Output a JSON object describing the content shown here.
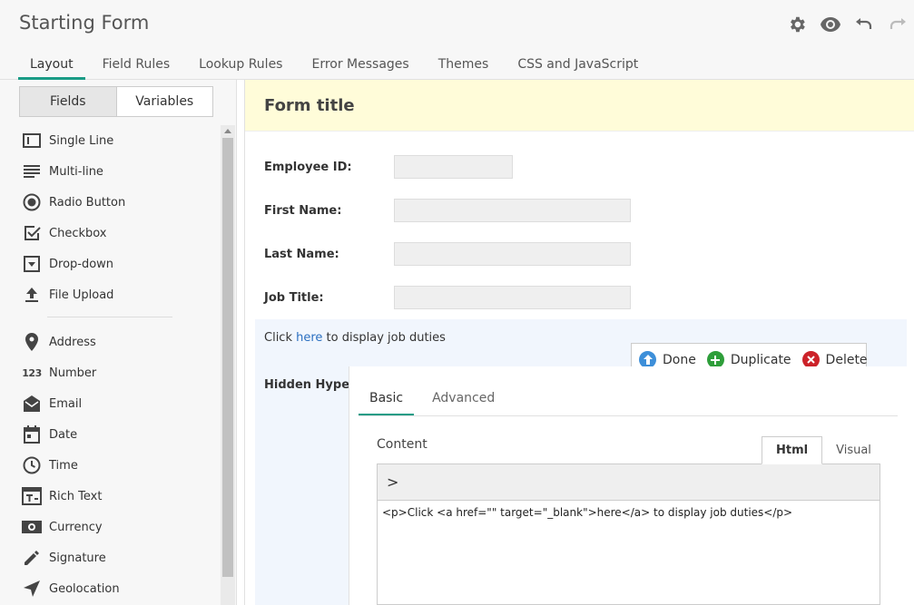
{
  "app": {
    "title": "Starting Form"
  },
  "header_icons": [
    {
      "name": "gear-icon",
      "interactable": true
    },
    {
      "name": "eye-icon",
      "interactable": true
    },
    {
      "name": "undo-icon",
      "interactable": true
    },
    {
      "name": "redo-icon",
      "interactable": false
    }
  ],
  "tabs": [
    {
      "label": "Layout",
      "active": true
    },
    {
      "label": "Field Rules"
    },
    {
      "label": "Lookup Rules"
    },
    {
      "label": "Error Messages"
    },
    {
      "label": "Themes"
    },
    {
      "label": "CSS and JavaScript"
    }
  ],
  "left_panel": {
    "segments": [
      {
        "label": "Fields",
        "active": true
      },
      {
        "label": "Variables"
      }
    ],
    "fields_group1": [
      {
        "label": "Single Line",
        "icon": "single-line-icon"
      },
      {
        "label": "Multi-line",
        "icon": "multi-line-icon"
      },
      {
        "label": "Radio Button",
        "icon": "radio-button-icon"
      },
      {
        "label": "Checkbox",
        "icon": "checkbox-icon"
      },
      {
        "label": "Drop-down",
        "icon": "dropdown-icon"
      },
      {
        "label": "File Upload",
        "icon": "file-upload-icon"
      }
    ],
    "fields_group2": [
      {
        "label": "Address",
        "icon": "map-pin-icon"
      },
      {
        "label": "Number",
        "icon": "number-icon",
        "glyph": "123"
      },
      {
        "label": "Email",
        "icon": "email-icon"
      },
      {
        "label": "Date",
        "icon": "calendar-icon"
      },
      {
        "label": "Time",
        "icon": "clock-icon"
      },
      {
        "label": "Rich Text",
        "icon": "rich-text-icon"
      },
      {
        "label": "Currency",
        "icon": "currency-icon"
      },
      {
        "label": "Signature",
        "icon": "pen-icon"
      },
      {
        "label": "Geolocation",
        "icon": "location-arrow-icon"
      }
    ]
  },
  "form": {
    "title": "Form title",
    "fields": [
      {
        "label": "Employee ID:"
      },
      {
        "label": "First Name:"
      },
      {
        "label": "Last Name:"
      },
      {
        "label": "Job Title:"
      }
    ],
    "click_text": {
      "before": "Click ",
      "link": "here",
      "after": " to display job duties"
    },
    "actions": [
      {
        "label": "Done",
        "color": "#3d8fd9",
        "icon": "arrow-up-icon"
      },
      {
        "label": "Duplicate",
        "color": "#2e9e3a",
        "icon": "plus-icon"
      },
      {
        "label": "Delete",
        "color": "#cc2229",
        "icon": "x-icon"
      }
    ],
    "hidden_label": "Hidden Hyperlink"
  },
  "properties": {
    "tabs": [
      {
        "label": "Basic",
        "active": true
      },
      {
        "label": "Advanced"
      }
    ],
    "content_label": "Content",
    "mode_tabs": [
      {
        "label": "Html",
        "active": true
      },
      {
        "label": "Visual"
      }
    ],
    "toolbar_glyph": ">",
    "html_value": "<p>Click <a href=\"\" target=\"_blank\">here</a> to display job duties</p>"
  },
  "colors": {
    "accent": "#1a9c86",
    "title_bar": "#fffcd9",
    "selection": "#f1f6fd",
    "link": "#2a6fc0"
  }
}
